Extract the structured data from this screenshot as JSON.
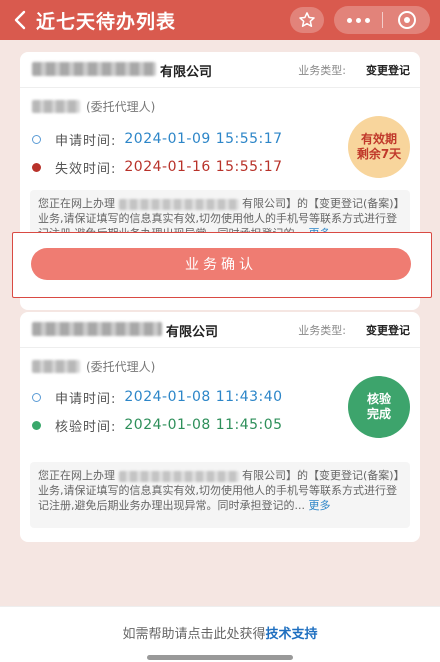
{
  "header": {
    "title": "近七天待办列表",
    "icons": {
      "back": "chevron-left-icon",
      "star": "star-icon",
      "more": "more-dots-icon",
      "close": "target-circle-icon"
    }
  },
  "cards": [
    {
      "company_suffix": "有限公司",
      "type_label": "业务类型:",
      "type_value": "变更登记",
      "agent_role": "(委托代理人)",
      "rows": [
        {
          "label": "申请时间:",
          "value": "2024-01-09 15:55:17"
        },
        {
          "label": "失效时间:",
          "value": "2024-01-16 15:55:17"
        }
      ],
      "badge": {
        "line1": "有效期",
        "line2": "剩余7天",
        "color": "#f8d59c"
      },
      "desc": {
        "prefix": "您正在网上办理",
        "mid": "有限公司】的【变更登记(备案)】业务,请保证填写的信息真实有效,切勿使用他人的手机号等联系方式进行登记注册,避免后期业务办理出现异常。同时承担登记的...",
        "more": "更多"
      },
      "button": "业务确认"
    },
    {
      "company_suffix": "有限公司",
      "type_label": "业务类型:",
      "type_value": "变更登记",
      "agent_role": "(委托代理人)",
      "rows": [
        {
          "label": "申请时间:",
          "value": "2024-01-08 11:43:40"
        },
        {
          "label": "核验时间:",
          "value": "2024-01-08 11:45:05"
        }
      ],
      "badge": {
        "line1": "核验",
        "line2": "完成",
        "color": "#3da46c"
      },
      "desc": {
        "prefix": "您正在网上办理",
        "mid": "有限公司】的【变更登记(备案)】业务,请保证填写的信息真实有效,切勿使用他人的手机号等联系方式进行登记注册,避免后期业务办理出现异常。同时承担登记的...",
        "more": "更多"
      }
    }
  ],
  "footer": {
    "text": "如需帮助请点击此处获得",
    "link": "技术支持"
  }
}
